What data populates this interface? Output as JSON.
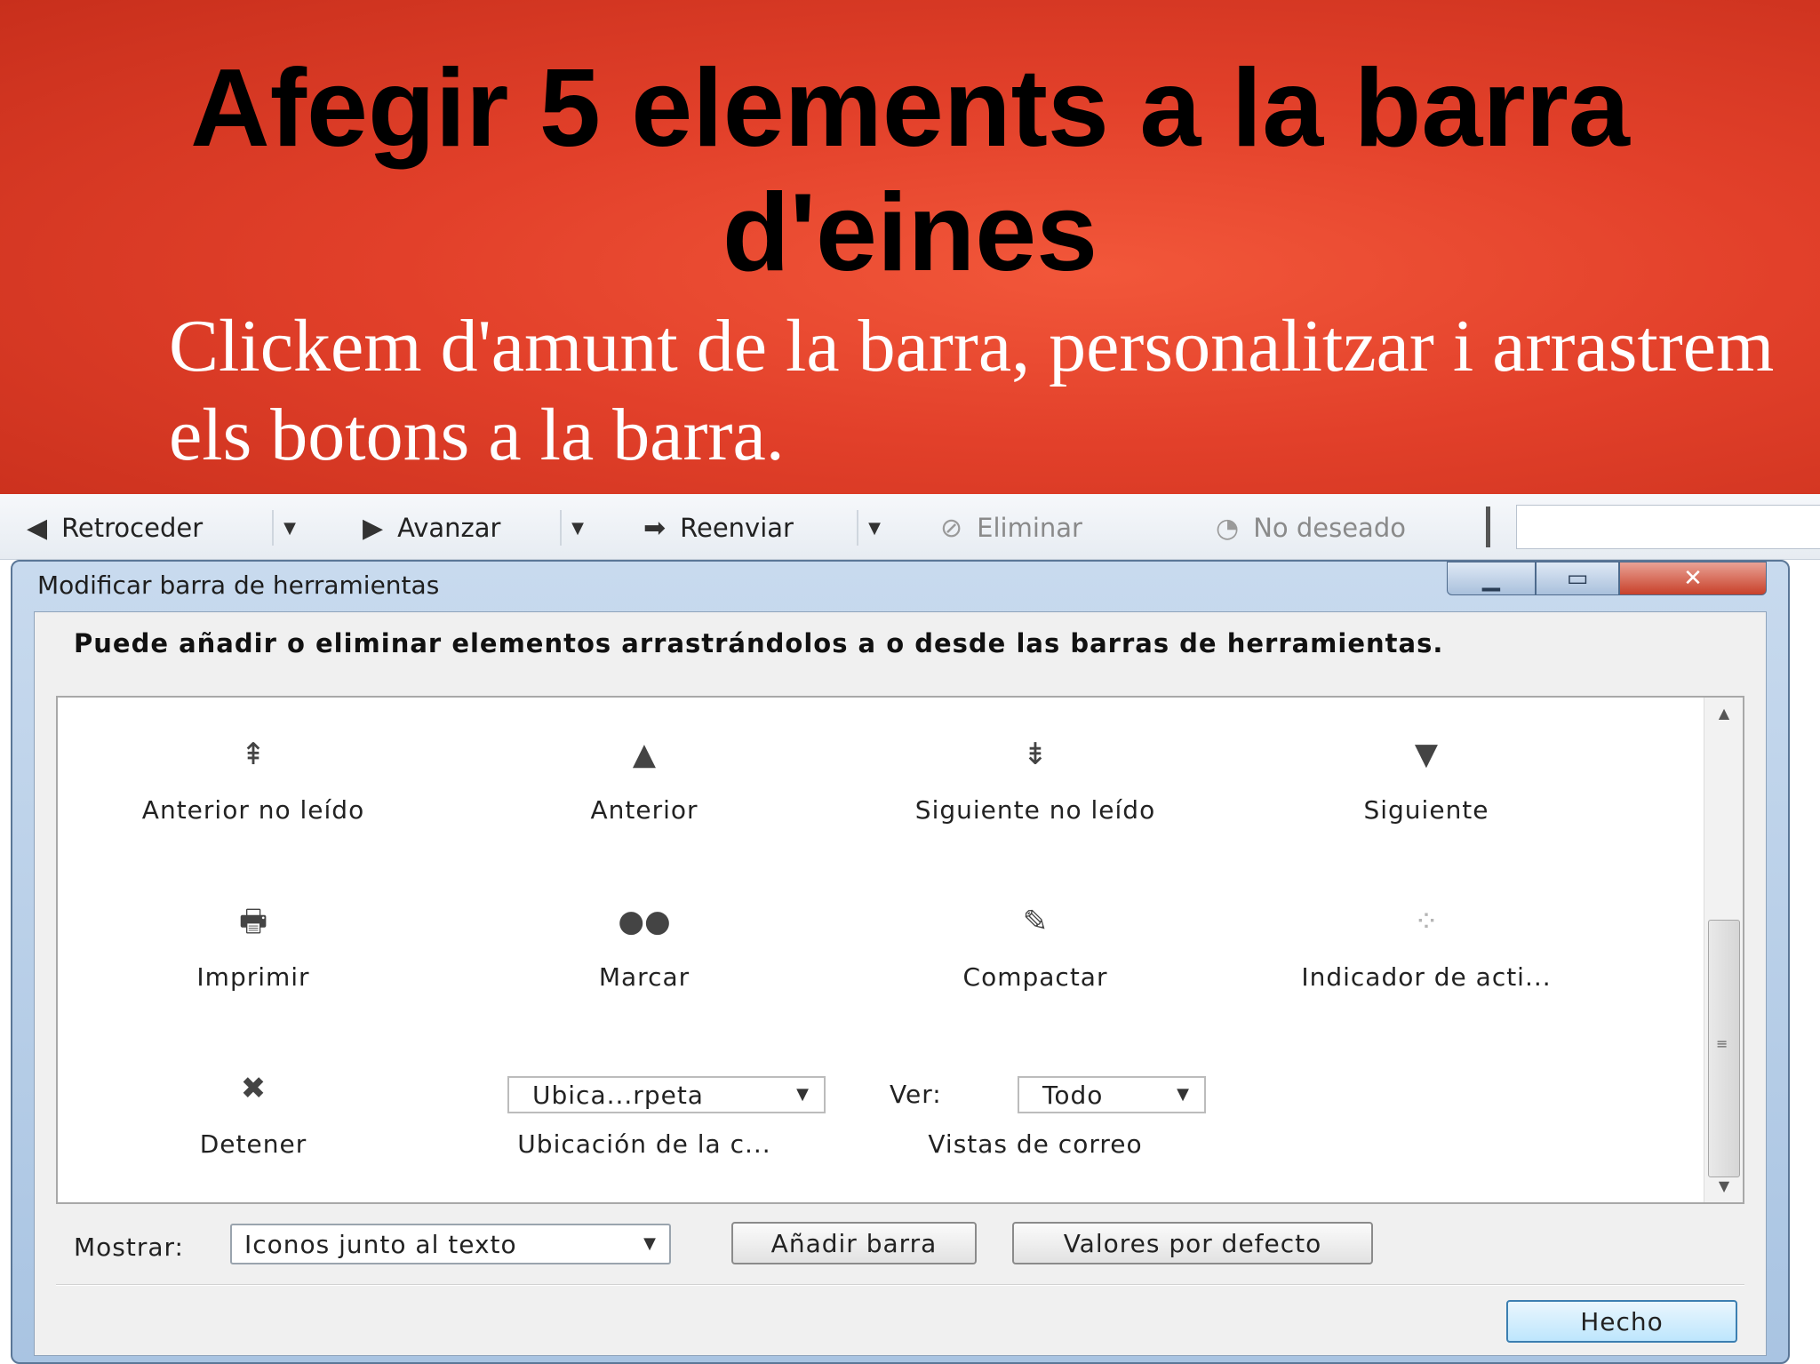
{
  "slide": {
    "title": "Afegir 5 elements a la barra d'eines",
    "body": "Clickem d'amunt de la barra, personalitzar i arrastrem els botons a la barra."
  },
  "mail_toolbar": {
    "back": "Retroceder",
    "forward": "Avanzar",
    "resend": "Reenviar",
    "delete": "Eliminar",
    "junk": "No deseado"
  },
  "dialog": {
    "title": "Modificar barra de herramientas",
    "window_buttons": {
      "minimize": "▁",
      "maximize": "▭",
      "close": "✕"
    },
    "instruction": "Puede añadir o eliminar elementos arrastrándolos a o desde las barras de herramientas.",
    "palette": [
      {
        "label": "Anterior no leído",
        "icon": "prev-unread-icon",
        "glyph": "⇞"
      },
      {
        "label": "Anterior",
        "icon": "prev-icon",
        "glyph": "▲"
      },
      {
        "label": "Siguiente no leído",
        "icon": "next-unread-icon",
        "glyph": "⇟"
      },
      {
        "label": "Siguiente",
        "icon": "next-icon",
        "glyph": "▼"
      },
      {
        "label": "Imprimir",
        "icon": "print-icon",
        "glyph": "🖶"
      },
      {
        "label": "Marcar",
        "icon": "mark-icon",
        "glyph": "●●"
      },
      {
        "label": "Compactar",
        "icon": "compact-icon",
        "glyph": "✎"
      },
      {
        "label": "Indicador de acti...",
        "icon": "activity-indicator-icon",
        "glyph": "⁘"
      },
      {
        "label": "Detener",
        "icon": "stop-icon",
        "glyph": "✖"
      },
      {
        "label": "Ubicación de la c...",
        "widget": "Ubica...rpeta"
      },
      {
        "label": "Vistas de correo",
        "widget_label": "Ver:",
        "widget": "Todo"
      }
    ],
    "show_label": "Mostrar:",
    "show_value": "Iconos junto al texto",
    "add_bar": "Añadir barra",
    "defaults": "Valores por defecto",
    "done": "Hecho"
  }
}
